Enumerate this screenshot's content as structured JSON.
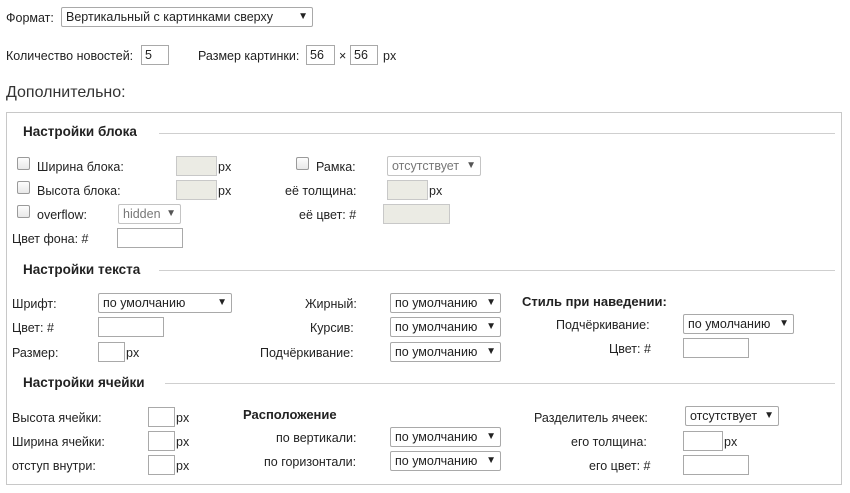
{
  "format": {
    "label": "Формат:",
    "value": "Вертикальный с картинками сверху"
  },
  "news_count": {
    "label": "Количество новостей:",
    "value": "5"
  },
  "image_size": {
    "label": "Размер картинки:",
    "width": "56",
    "sep": "×",
    "height": "56",
    "unit": "px"
  },
  "additional_title": "Дополнительно:",
  "block": {
    "title": "Настройки блока",
    "width_label": "Ширина блока:",
    "height_label": "Высота блока:",
    "overflow_label": "overflow:",
    "overflow_value": "hidden",
    "bg_label": "Цвет фона: #",
    "border_label": "Рамка:",
    "border_value": "отсутствует",
    "thickness_label": "её толщина:",
    "color_label": "её цвет: #",
    "unit": "px"
  },
  "text": {
    "title": "Настройки текста",
    "font_label": "Шрифт:",
    "font_value": "по умолчанию",
    "color_label": "Цвет: #",
    "size_label": "Размер:",
    "unit": "px",
    "bold_label": "Жирный:",
    "italic_label": "Курсив:",
    "underline_label": "Подчёркивание:",
    "default_value": "по умолчанию",
    "hover_title": "Стиль при наведении:",
    "hover_underline_label": "Подчёркивание:",
    "hover_color_label": "Цвет: #"
  },
  "cell": {
    "title": "Настройки ячейки",
    "height_label": "Высота ячейки:",
    "width_label": "Ширина ячейки:",
    "padding_label": "отступ внутри:",
    "unit": "px",
    "position_title": "Расположение",
    "vertical_label": "по вертикали:",
    "horizontal_label": "по горизонтали:",
    "default_value": "по умолчанию",
    "separator_label": "Разделитель ячеек:",
    "separator_value": "отсутствует",
    "its_thickness_label": "его толщина:",
    "its_color_label": "его цвет: #"
  },
  "icons": {
    "dropdown": "▼"
  }
}
